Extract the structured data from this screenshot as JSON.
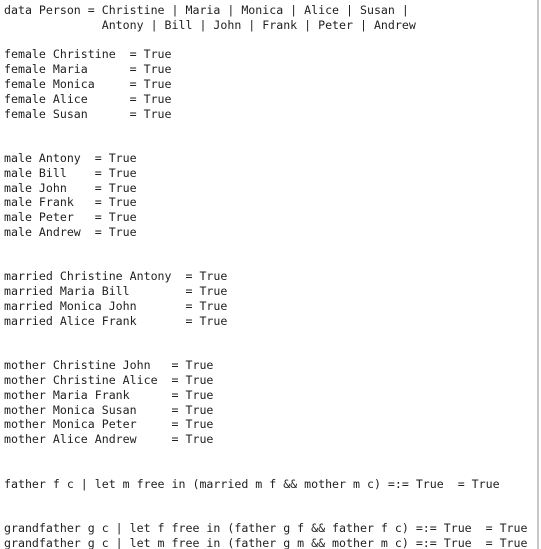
{
  "editor": {
    "lines": [
      "data Person = Christine | Maria | Monica | Alice | Susan |",
      "              Antony | Bill | John | Frank | Peter | Andrew",
      "",
      "female Christine  = True",
      "female Maria      = True",
      "female Monica     = True",
      "female Alice      = True",
      "female Susan      = True",
      "",
      "",
      "male Antony  = True",
      "male Bill    = True",
      "male John    = True",
      "male Frank   = True",
      "male Peter   = True",
      "male Andrew  = True",
      "",
      "",
      "married Christine Antony  = True",
      "married Maria Bill        = True",
      "married Monica John       = True",
      "married Alice Frank       = True",
      "",
      "",
      "mother Christine John   = True",
      "mother Christine Alice  = True",
      "mother Maria Frank      = True",
      "mother Monica Susan     = True",
      "mother Monica Peter     = True",
      "mother Alice Andrew     = True",
      "",
      "",
      "father f c | let m free in (married m f && mother m c) =:= True  = True",
      "",
      "",
      "grandfather g c | let f free in (father g f && father f c) =:= True  = True",
      "grandfather g c | let m free in (father g m && mother m c) =:= True  = True"
    ]
  }
}
